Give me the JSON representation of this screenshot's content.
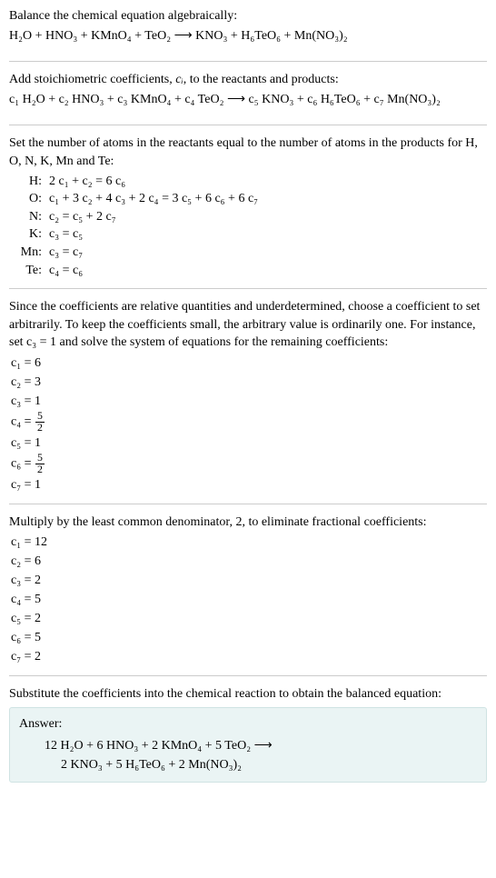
{
  "s1": {
    "intro": "Balance the chemical equation algebraically:",
    "eq": "H₂O + HNO₃ + KMnO₄ + TeO₂  ⟶  KNO₃ + H₆TeO₆ + Mn(NO₃)₂"
  },
  "s2": {
    "intro_a": "Add stoichiometric coefficients, ",
    "ci": "cᵢ",
    "intro_b": ", to the reactants and products:",
    "eq": "c₁ H₂O + c₂ HNO₃ + c₃ KMnO₄ + c₄ TeO₂  ⟶  c₅ KNO₃ + c₆ H₆TeO₆ + c₇ Mn(NO₃)₂"
  },
  "s3": {
    "intro": "Set the number of atoms in the reactants equal to the number of atoms in the products for H, O, N, K, Mn and Te:",
    "rows": [
      {
        "label": "H:",
        "eq": "2 c₁ + c₂ = 6 c₆"
      },
      {
        "label": "O:",
        "eq": "c₁ + 3 c₂ + 4 c₃ + 2 c₄ = 3 c₅ + 6 c₆ + 6 c₇"
      },
      {
        "label": "N:",
        "eq": "c₂ = c₅ + 2 c₇"
      },
      {
        "label": "K:",
        "eq": "c₃ = c₅"
      },
      {
        "label": "Mn:",
        "eq": "c₃ = c₇"
      },
      {
        "label": "Te:",
        "eq": "c₄ = c₆"
      }
    ]
  },
  "s4": {
    "intro": "Since the coefficients are relative quantities and underdetermined, choose a coefficient to set arbitrarily. To keep the coefficients small, the arbitrary value is ordinarily one. For instance, set c₃ = 1 and solve the system of equations for the remaining coefficients:",
    "c1": "c₁ = 6",
    "c2": "c₂ = 3",
    "c3": "c₃ = 1",
    "c4a": "c₄ = ",
    "c4num": "5",
    "c4den": "2",
    "c5": "c₅ = 1",
    "c6a": "c₆ = ",
    "c6num": "5",
    "c6den": "2",
    "c7": "c₇ = 1"
  },
  "s5": {
    "intro": "Multiply by the least common denominator, 2, to eliminate fractional coefficients:",
    "lines": [
      "c₁ = 12",
      "c₂ = 6",
      "c₃ = 2",
      "c₄ = 5",
      "c₅ = 2",
      "c₆ = 5",
      "c₇ = 2"
    ]
  },
  "s6": {
    "intro": "Substitute the coefficients into the chemical reaction to obtain the balanced equation:",
    "answer_label": "Answer:",
    "line1": "12 H₂O + 6 HNO₃ + 2 KMnO₄ + 5 TeO₂  ⟶",
    "line2": "2 KNO₃ + 5 H₆TeO₆ + 2 Mn(NO₃)₂"
  },
  "chart_data": {
    "type": "table",
    "title": "Balanced chemical equation stoichiometric coefficients",
    "species": [
      "H₂O",
      "HNO₃",
      "KMnO₄",
      "TeO₂",
      "KNO₃",
      "H₆TeO₆",
      "Mn(NO₃)₂"
    ],
    "side": [
      "reactant",
      "reactant",
      "reactant",
      "reactant",
      "product",
      "product",
      "product"
    ],
    "coefficients_initial": [
      6,
      3,
      1,
      2.5,
      1,
      2.5,
      1
    ],
    "coefficients_final": [
      12,
      6,
      2,
      5,
      2,
      5,
      2
    ],
    "atom_balance": [
      {
        "element": "H",
        "equation": "2 c1 + c2 = 6 c6"
      },
      {
        "element": "O",
        "equation": "c1 + 3 c2 + 4 c3 + 2 c4 = 3 c5 + 6 c6 + 6 c7"
      },
      {
        "element": "N",
        "equation": "c2 = c5 + 2 c7"
      },
      {
        "element": "K",
        "equation": "c3 = c5"
      },
      {
        "element": "Mn",
        "equation": "c3 = c7"
      },
      {
        "element": "Te",
        "equation": "c4 = c6"
      }
    ]
  }
}
